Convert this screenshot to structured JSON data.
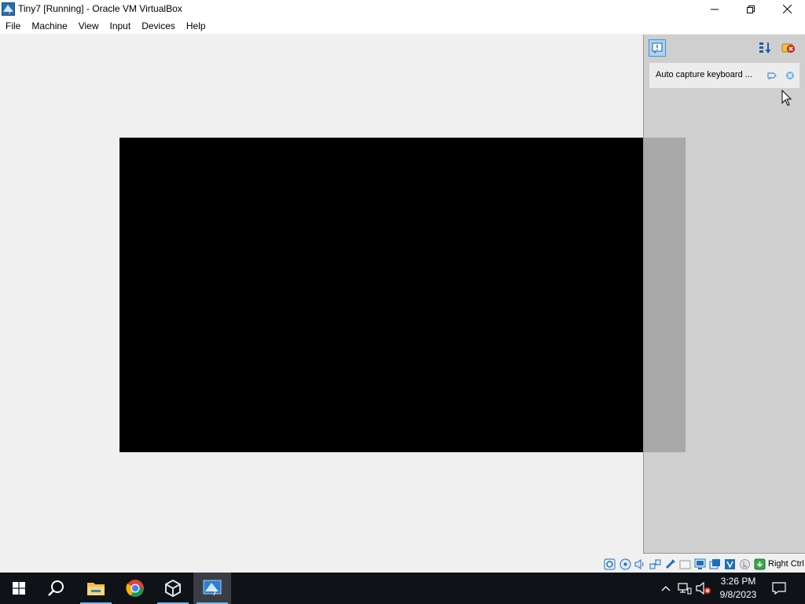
{
  "window": {
    "title": "Tiny7 [Running] - Oracle VM VirtualBox",
    "icon": "virtualbox-vm-icon"
  },
  "menu": {
    "items": [
      {
        "label": "File"
      },
      {
        "label": "Machine"
      },
      {
        "label": "View"
      },
      {
        "label": "Input"
      },
      {
        "label": "Devices"
      },
      {
        "label": "Help"
      }
    ]
  },
  "notification_center": {
    "message": "Auto capture keyboard ...",
    "icons": [
      "notification-center-icon",
      "sort-order-icon",
      "close-all-icon",
      "pin-icon",
      "dismiss-icon"
    ]
  },
  "statusbar": {
    "icons": [
      "hard-disk-icon",
      "optical-drive-icon",
      "audio-icon",
      "network-icon",
      "usb-icon",
      "shared-folders-icon",
      "display-icon",
      "video-capture-icon",
      "vt-x-icon",
      "mouse-integration-icon",
      "keyboard-capture-icon"
    ],
    "host_key": "Right Ctrl"
  },
  "taskbar": {
    "apps": [
      "start-icon",
      "search-icon",
      "file-explorer-icon",
      "chrome-icon",
      "virtualbox-manager-icon",
      "virtualbox-vm-icon"
    ],
    "tray": [
      "show-hidden-icons-icon",
      "network-icon",
      "volume-muted-icon"
    ],
    "time": "3:26 PM",
    "date": "9/8/2023"
  },
  "colors": {
    "taskbar": "#0f1217",
    "vm_screen": "#000000",
    "panel": "#cfcfcf",
    "accent": "#1e90ff"
  }
}
